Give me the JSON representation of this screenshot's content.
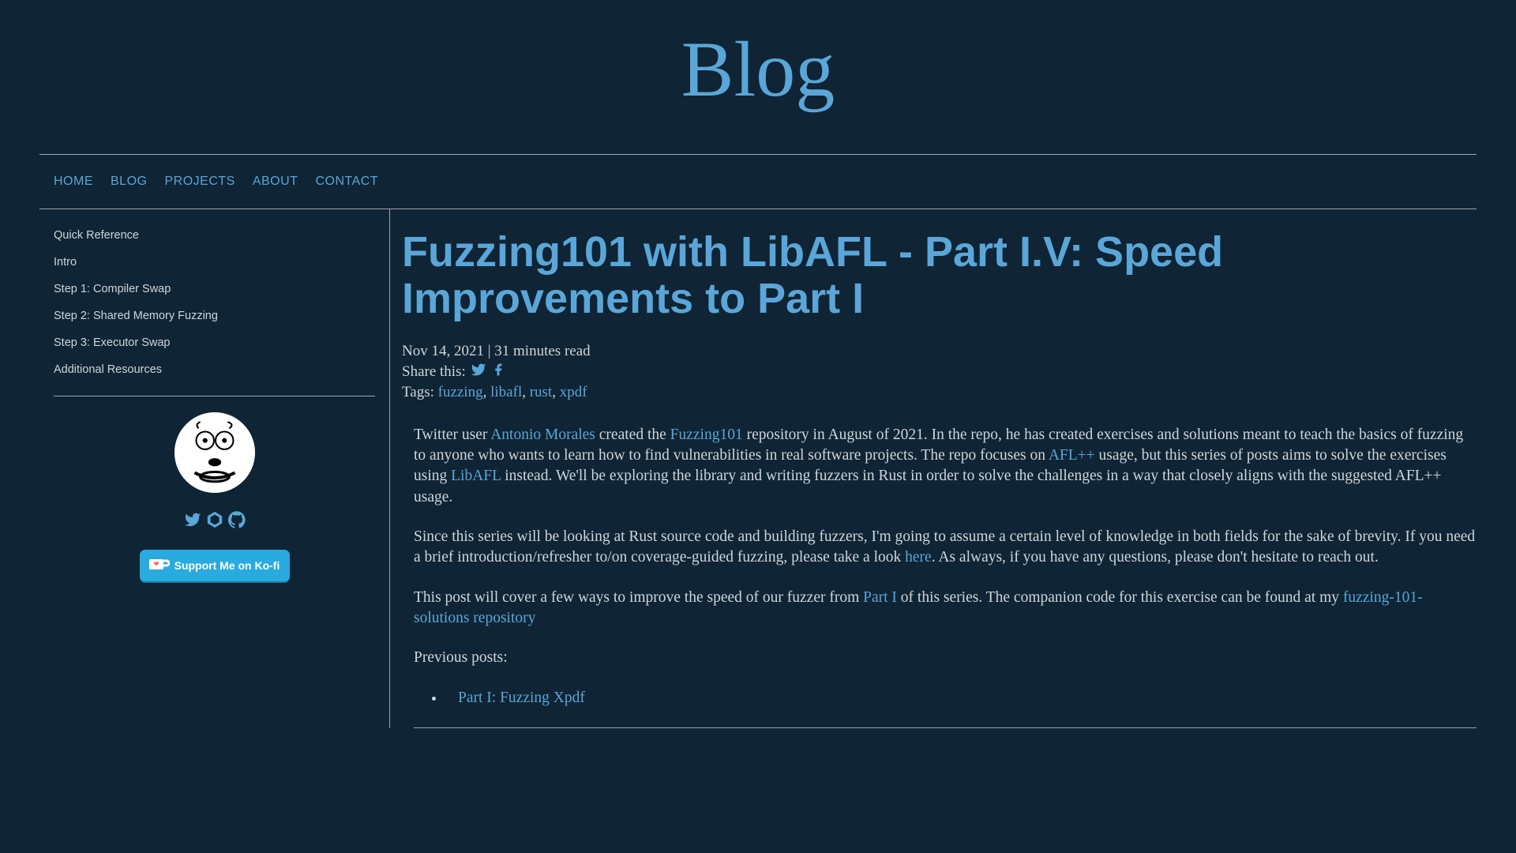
{
  "pageTitle": "Blog",
  "nav": [
    {
      "label": "HOME"
    },
    {
      "label": "BLOG"
    },
    {
      "label": "PROJECTS"
    },
    {
      "label": "ABOUT"
    },
    {
      "label": "CONTACT"
    }
  ],
  "toc": [
    "Quick Reference",
    "Intro",
    "Step 1: Compiler Swap",
    "Step 2: Shared Memory Fuzzing",
    "Step 3: Executor Swap",
    "Additional Resources"
  ],
  "kofi": "Support Me on Ko-fi",
  "articleTitle": "Fuzzing101 with LibAFL - Part I.V: Speed Improvements to Part I",
  "meta": {
    "dateRead": "Nov 14, 2021 | 31 minutes read",
    "shareLabel": "Share this:",
    "tagsLabel": "Tags: ",
    "tags": [
      "fuzzing",
      "libafl",
      "rust",
      "xpdf"
    ]
  },
  "body": {
    "p1a": "Twitter user ",
    "p1link1": "Antonio Morales",
    "p1b": " created the ",
    "p1link2": "Fuzzing101",
    "p1c": " repository in August of 2021. In the repo, he has created exercises and solutions meant to teach the basics of fuzzing to anyone who wants to learn how to find vulnerabilities in real software projects. The repo focuses on ",
    "p1link3": "AFL++",
    "p1d": " usage, but this series of posts aims to solve the exercises using ",
    "p1link4": "LibAFL",
    "p1e": " instead. We'll be exploring the library and writing fuzzers in Rust in order to solve the challenges in a way that closely aligns with the suggested AFL++ usage.",
    "p2a": "Since this series will be looking at Rust source code and building fuzzers, I'm going to assume a certain level of knowledge in both fields for the sake of brevity. If you need a brief introduction/refresher to/on coverage-guided fuzzing, please take a look ",
    "p2link": "here",
    "p2b": ". As always, if you have any questions, please don't hesitate to reach out.",
    "p3a": "This post will cover a few ways to improve the speed of our fuzzer from ",
    "p3link1": "Part I",
    "p3b": " of this series. The companion code for this exercise can be found at my ",
    "p3link2": "fuzzing-101-solutions repository",
    "p4": "Previous posts:",
    "li1": "Part I: Fuzzing Xpdf"
  }
}
